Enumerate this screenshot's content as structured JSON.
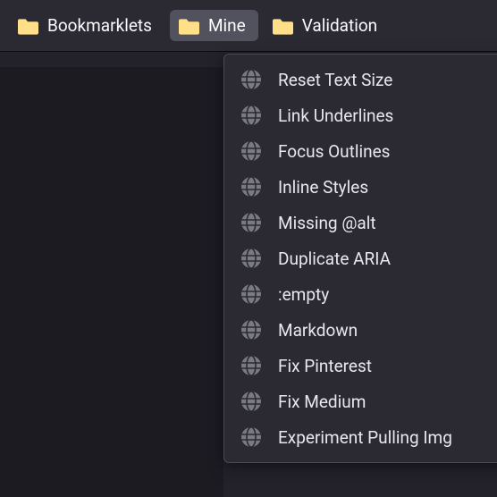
{
  "toolbar": {
    "items": [
      {
        "label": "Bookmarklets",
        "active": false
      },
      {
        "label": "Mine",
        "active": true
      },
      {
        "label": "Validation",
        "active": false
      }
    ]
  },
  "menu": {
    "items": [
      {
        "label": "Reset Text Size"
      },
      {
        "label": "Link Underlines"
      },
      {
        "label": "Focus Outlines"
      },
      {
        "label": "Inline Styles"
      },
      {
        "label": "Missing @alt"
      },
      {
        "label": "Duplicate ARIA"
      },
      {
        "label": ":empty"
      },
      {
        "label": "Markdown"
      },
      {
        "label": "Fix Pinterest"
      },
      {
        "label": "Fix Medium"
      },
      {
        "label": "Experiment Pulling Img"
      }
    ]
  }
}
